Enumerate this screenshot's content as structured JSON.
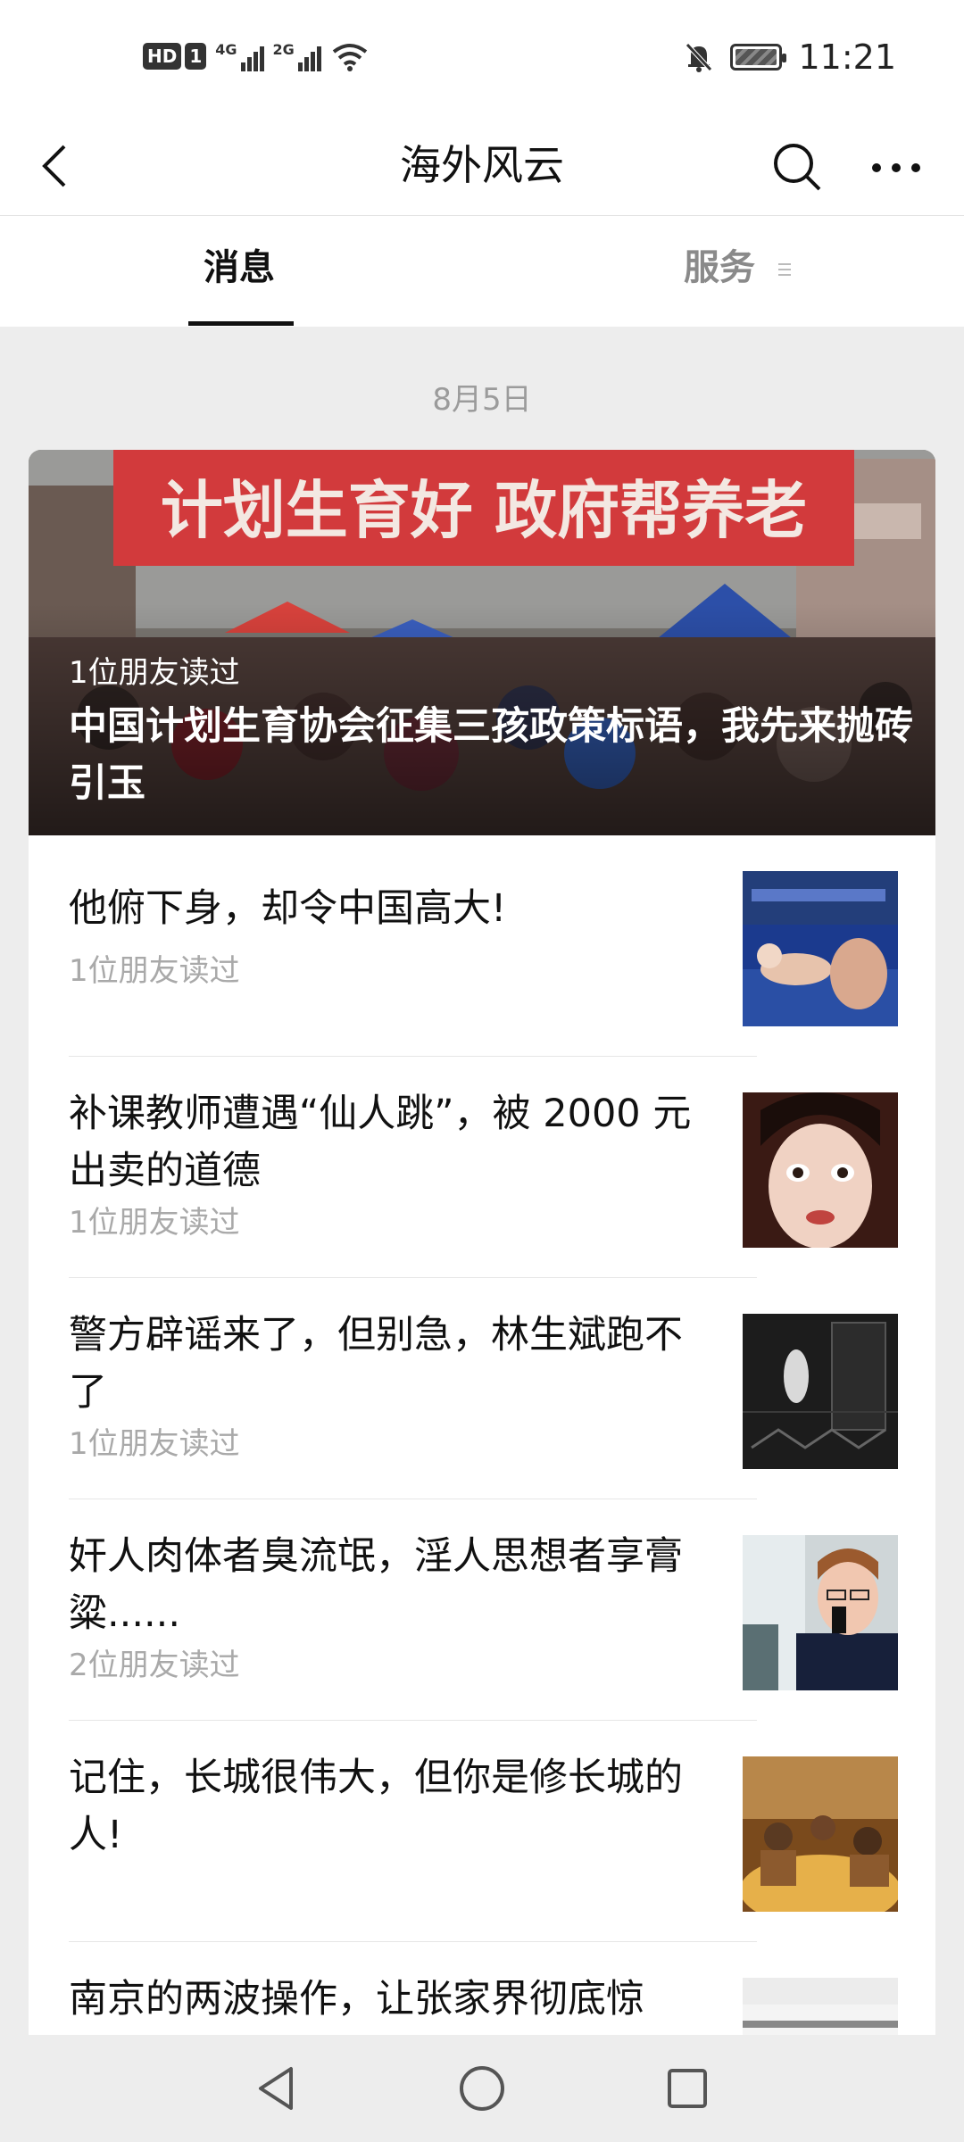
{
  "status_bar": {
    "time": "11:21",
    "hd": "HD",
    "sim": "1",
    "net1": "4G",
    "net2": "2G"
  },
  "nav": {
    "title": "海外风云"
  },
  "tabs": [
    {
      "label": "消息"
    },
    {
      "label": "服务"
    }
  ],
  "date": "8月5日",
  "hero": {
    "banner_text": "计划生育好 政府帮养老",
    "friends": "1位朋友读过",
    "title": "中国计划生育协会征集三孩政策标语，我先来抛砖引玉"
  },
  "articles": [
    {
      "title": "他俯下身，却令中国高大!",
      "friends": "1位朋友读过"
    },
    {
      "title": "补课教师遭遇“仙人跳”，被 2000 元出卖的道德",
      "friends": "1位朋友读过"
    },
    {
      "title": "警方辟谣来了，但别急，林生斌跑不了",
      "friends": "1位朋友读过"
    },
    {
      "title": "奸人肉体者臭流氓，淫人思想者享膏粱......",
      "friends": "2位朋友读过"
    },
    {
      "title": "记住，长城很伟大，但你是修长城的人!",
      "friends": ""
    },
    {
      "title": "南京的两波操作，让张家界彻底惊",
      "friends": ""
    }
  ],
  "colors": {
    "accent": "#111111",
    "muted": "#a9a9a9",
    "background": "#ededed"
  }
}
